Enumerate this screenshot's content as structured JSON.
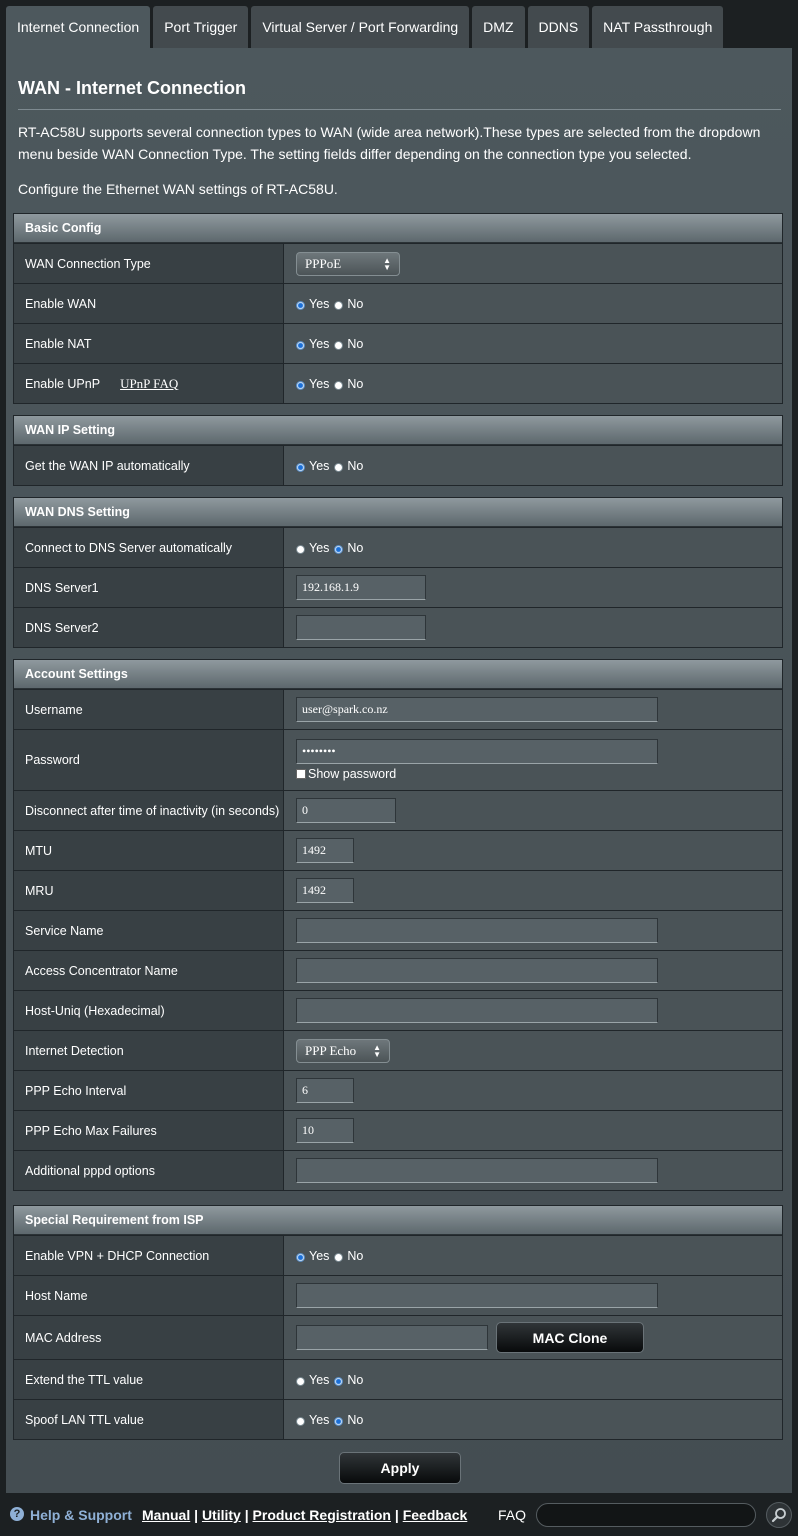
{
  "tabs": [
    "Internet Connection",
    "Port Trigger",
    "Virtual Server / Port Forwarding",
    "DMZ",
    "DDNS",
    "NAT Passthrough"
  ],
  "page": {
    "title": "WAN - Internet Connection",
    "description": "RT-AC58U supports several connection types to WAN (wide area network).These types are selected from the dropdown menu beside WAN Connection Type. The setting fields differ depending on the connection type you selected.",
    "description2": "Configure the Ethernet WAN settings of RT-AC58U."
  },
  "radio": {
    "yes": "Yes",
    "no": "No"
  },
  "basic": {
    "header": "Basic Config",
    "wan_type_label": "WAN Connection Type",
    "wan_type_value": "PPPoE",
    "enable_wan_label": "Enable WAN",
    "enable_nat_label": "Enable NAT",
    "enable_upnp_label": "Enable UPnP",
    "upnp_faq": "UPnP FAQ"
  },
  "wanip": {
    "header": "WAN IP Setting",
    "auto_label": "Get the WAN IP automatically"
  },
  "dns": {
    "header": "WAN DNS Setting",
    "auto_label": "Connect to DNS Server automatically",
    "dns1_label": "DNS Server1",
    "dns1_value": "192.168.1.9",
    "dns2_label": "DNS Server2",
    "dns2_value": ""
  },
  "account": {
    "header": "Account Settings",
    "username_label": "Username",
    "username_value": "user@spark.co.nz",
    "password_label": "Password",
    "password_value": "••••••••",
    "show_password": "Show password",
    "idle_label": "Disconnect after time of inactivity (in seconds)",
    "idle_value": "0",
    "mtu_label": "MTU",
    "mtu_value": "1492",
    "mru_label": "MRU",
    "mru_value": "1492",
    "service_label": "Service Name",
    "ac_label": "Access Concentrator Name",
    "hostuniq_label": "Host-Uniq (Hexadecimal)",
    "detect_label": "Internet Detection",
    "detect_value": "PPP Echo",
    "echo_interval_label": "PPP Echo Interval",
    "echo_interval_value": "6",
    "echo_fail_label": "PPP Echo Max Failures",
    "echo_fail_value": "10",
    "pppd_label": "Additional pppd options"
  },
  "isp": {
    "header": "Special Requirement from ISP",
    "vpn_label": "Enable VPN + DHCP Connection",
    "host_label": "Host Name",
    "mac_label": "MAC Address",
    "mac_clone": "MAC Clone",
    "ttl_label": "Extend the TTL value",
    "spoof_label": "Spoof LAN TTL value"
  },
  "apply": "Apply",
  "footer": {
    "help": "Help & Support",
    "manual": "Manual",
    "utility": "Utility",
    "registration": "Product Registration",
    "feedback": "Feedback",
    "faq": "FAQ"
  }
}
